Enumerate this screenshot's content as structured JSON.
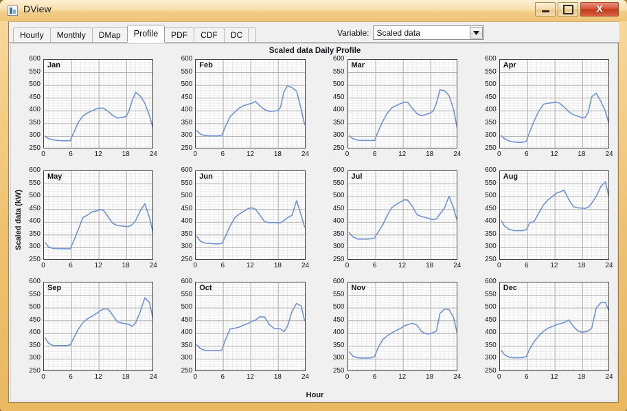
{
  "window": {
    "title": "DView",
    "icon": "app-chart-icon",
    "buttons": {
      "minimize": "minimize-button",
      "maximize": "maximize-button",
      "close": "X"
    }
  },
  "tabs": [
    {
      "label": "Hourly",
      "active": false
    },
    {
      "label": "Monthly",
      "active": false
    },
    {
      "label": "DMap",
      "active": false
    },
    {
      "label": "Profile",
      "active": true
    },
    {
      "label": "PDF",
      "active": false
    },
    {
      "label": "CDF",
      "active": false
    },
    {
      "label": "DC",
      "active": false
    }
  ],
  "variable": {
    "label": "Variable:",
    "value": "Scaled data",
    "options": [
      "Scaled data"
    ],
    "arrow_icon": "chevron-down-icon"
  },
  "chart_data": {
    "type": "line",
    "title": "Scaled data Daily Profile",
    "xlabel": "Hour",
    "ylabel": "Scaled data (kW)",
    "xlim": [
      0,
      24
    ],
    "ylim": [
      250,
      600
    ],
    "xticks": [
      0,
      6,
      12,
      18,
      24
    ],
    "yticks": [
      250,
      300,
      350,
      400,
      450,
      500,
      550,
      600
    ],
    "grid": true,
    "minor_grid": true,
    "legend": "none",
    "line_color": "#6f92d4",
    "layout": {
      "rows": 3,
      "cols": 4
    },
    "x": [
      0.25,
      1,
      2,
      3,
      4,
      5,
      5.75,
      6.5,
      7.5,
      8.5,
      9.5,
      10.5,
      11.5,
      12.25,
      13,
      14,
      15,
      16,
      17,
      17.9,
      18.5,
      19.25,
      20,
      21,
      22,
      23,
      23.75
    ],
    "series": [
      {
        "name": "Jan",
        "values": [
          301,
          291,
          286,
          284,
          283,
          283,
          283,
          315,
          355,
          380,
          392,
          400,
          408,
          411,
          410,
          398,
          382,
          372,
          374,
          378,
          398,
          440,
          473,
          458,
          430,
          382,
          334
        ]
      },
      {
        "name": "Feb",
        "values": [
          323,
          309,
          303,
          302,
          302,
          302,
          305,
          340,
          377,
          395,
          411,
          421,
          426,
          430,
          437,
          420,
          405,
          398,
          399,
          401,
          415,
          475,
          498,
          491,
          477,
          406,
          346
        ]
      },
      {
        "name": "Mar",
        "values": [
          302,
          291,
          285,
          284,
          284,
          284,
          284,
          317,
          358,
          390,
          412,
          421,
          429,
          434,
          433,
          410,
          389,
          381,
          386,
          392,
          398,
          430,
          482,
          479,
          460,
          405,
          334
        ]
      },
      {
        "name": "Apr",
        "values": [
          303,
          291,
          282,
          278,
          276,
          277,
          281,
          318,
          362,
          400,
          426,
          430,
          432,
          434,
          430,
          415,
          397,
          385,
          379,
          373,
          372,
          394,
          455,
          469,
          437,
          398,
          351
        ]
      },
      {
        "name": "May",
        "values": [
          320,
          303,
          297,
          297,
          296,
          296,
          296,
          327,
          372,
          418,
          428,
          441,
          444,
          450,
          446,
          421,
          396,
          387,
          385,
          383,
          383,
          390,
          407,
          444,
          473,
          418,
          362
        ]
      },
      {
        "name": "Jun",
        "values": [
          344,
          326,
          318,
          317,
          315,
          315,
          317,
          345,
          385,
          417,
          432,
          443,
          454,
          456,
          451,
          428,
          402,
          398,
          399,
          397,
          398,
          407,
          417,
          427,
          485,
          427,
          381
        ]
      },
      {
        "name": "Jul",
        "values": [
          359,
          343,
          334,
          334,
          334,
          335,
          338,
          360,
          388,
          426,
          457,
          470,
          480,
          488,
          486,
          462,
          430,
          422,
          418,
          413,
          410,
          413,
          432,
          455,
          502,
          455,
          406
        ]
      },
      {
        "name": "Aug",
        "values": [
          406,
          385,
          372,
          367,
          367,
          367,
          371,
          397,
          404,
          437,
          468,
          488,
          501,
          513,
          518,
          525,
          489,
          461,
          456,
          455,
          454,
          458,
          474,
          501,
          540,
          558,
          500,
          458
        ]
      },
      {
        "name": "Sep",
        "values": [
          383,
          362,
          353,
          353,
          353,
          353,
          356,
          383,
          417,
          443,
          458,
          468,
          479,
          489,
          496,
          496,
          472,
          446,
          441,
          438,
          436,
          428,
          442,
          486,
          540,
          522,
          460,
          418
        ]
      },
      {
        "name": "Oct",
        "values": [
          356,
          341,
          334,
          333,
          333,
          333,
          336,
          377,
          418,
          421,
          425,
          434,
          440,
          448,
          452,
          466,
          465,
          436,
          421,
          419,
          418,
          407,
          428,
          487,
          518,
          508,
          450,
          391
        ]
      },
      {
        "name": "Nov",
        "values": [
          328,
          312,
          305,
          304,
          304,
          305,
          310,
          343,
          375,
          391,
          403,
          412,
          421,
          430,
          435,
          440,
          433,
          408,
          399,
          399,
          404,
          410,
          478,
          496,
          494,
          462,
          402,
          358
        ]
      },
      {
        "name": "Dec",
        "values": [
          335,
          317,
          307,
          305,
          305,
          306,
          310,
          340,
          369,
          392,
          409,
          421,
          428,
          434,
          438,
          443,
          453,
          428,
          410,
          405,
          407,
          410,
          420,
          500,
          521,
          522,
          490,
          420,
          373
        ]
      }
    ]
  }
}
